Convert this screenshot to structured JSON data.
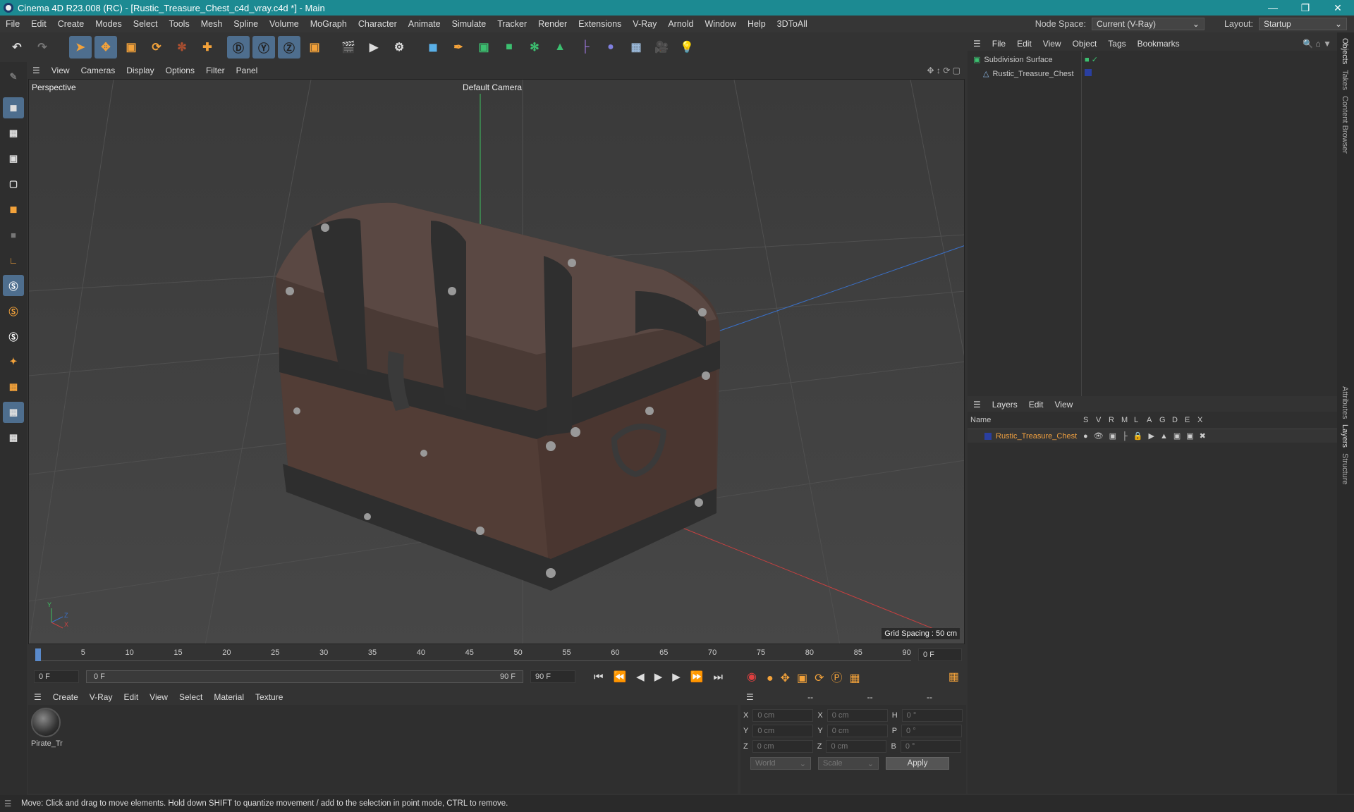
{
  "window": {
    "title": "Cinema 4D R23.008 (RC) - [Rustic_Treasure_Chest_c4d_vray.c4d *] - Main"
  },
  "menu": [
    "File",
    "Edit",
    "Create",
    "Modes",
    "Select",
    "Tools",
    "Mesh",
    "Spline",
    "Volume",
    "MoGraph",
    "Character",
    "Animate",
    "Simulate",
    "Tracker",
    "Render",
    "Extensions",
    "V-Ray",
    "Arnold",
    "Window",
    "Help",
    "3DToAll"
  ],
  "nodespace": {
    "label": "Node Space:",
    "value": "Current (V-Ray)"
  },
  "layout": {
    "label": "Layout:",
    "value": "Startup"
  },
  "viewport": {
    "menu": [
      "View",
      "Cameras",
      "Display",
      "Options",
      "Filter",
      "Panel"
    ],
    "name": "Perspective",
    "camera": "Default Camera",
    "grid": "Grid Spacing : 50 cm",
    "axis_y": "Y",
    "axis_z": "Z",
    "axis_x": "X"
  },
  "timeline": {
    "ticks": [
      "0",
      "5",
      "10",
      "15",
      "20",
      "25",
      "30",
      "35",
      "40",
      "45",
      "50",
      "55",
      "60",
      "65",
      "70",
      "75",
      "80",
      "85",
      "90"
    ],
    "current": "0 F"
  },
  "transport": {
    "start": "0 F",
    "range_start": "0 F",
    "range_end": "90 F",
    "end": "90 F"
  },
  "material": {
    "menu": [
      "Create",
      "V-Ray",
      "Edit",
      "View",
      "Select",
      "Material",
      "Texture"
    ],
    "item": "Pirate_Tr"
  },
  "coords": {
    "headers": [
      "--",
      "--",
      "--"
    ],
    "rows": [
      {
        "a": "X",
        "av": "0 cm",
        "b": "X",
        "bv": "0 cm",
        "c": "H",
        "cv": "0 °"
      },
      {
        "a": "Y",
        "av": "0 cm",
        "b": "Y",
        "bv": "0 cm",
        "c": "P",
        "cv": "0 °"
      },
      {
        "a": "Z",
        "av": "0 cm",
        "b": "Z",
        "bv": "0 cm",
        "c": "B",
        "cv": "0 °"
      }
    ],
    "mode": "World",
    "scale": "Scale",
    "apply": "Apply"
  },
  "objects": {
    "menu": [
      "File",
      "Edit",
      "View",
      "Object",
      "Tags",
      "Bookmarks"
    ],
    "items": [
      "Subdivision Surface",
      "Rustic_Treasure_Chest"
    ]
  },
  "layers": {
    "menu": [
      "Layers",
      "Edit",
      "View"
    ],
    "columns": [
      "Name",
      "S",
      "V",
      "R",
      "M",
      "L",
      "A",
      "G",
      "D",
      "E",
      "X"
    ],
    "item": "Rustic_Treasure_Chest"
  },
  "sidetabs": [
    "Objects",
    "Takes",
    "Content Browser",
    "Attributes",
    "Layers",
    "Structure"
  ],
  "status": "Move: Click and drag to move elements. Hold down SHIFT to quantize movement / add to the selection in point mode, CTRL to remove."
}
